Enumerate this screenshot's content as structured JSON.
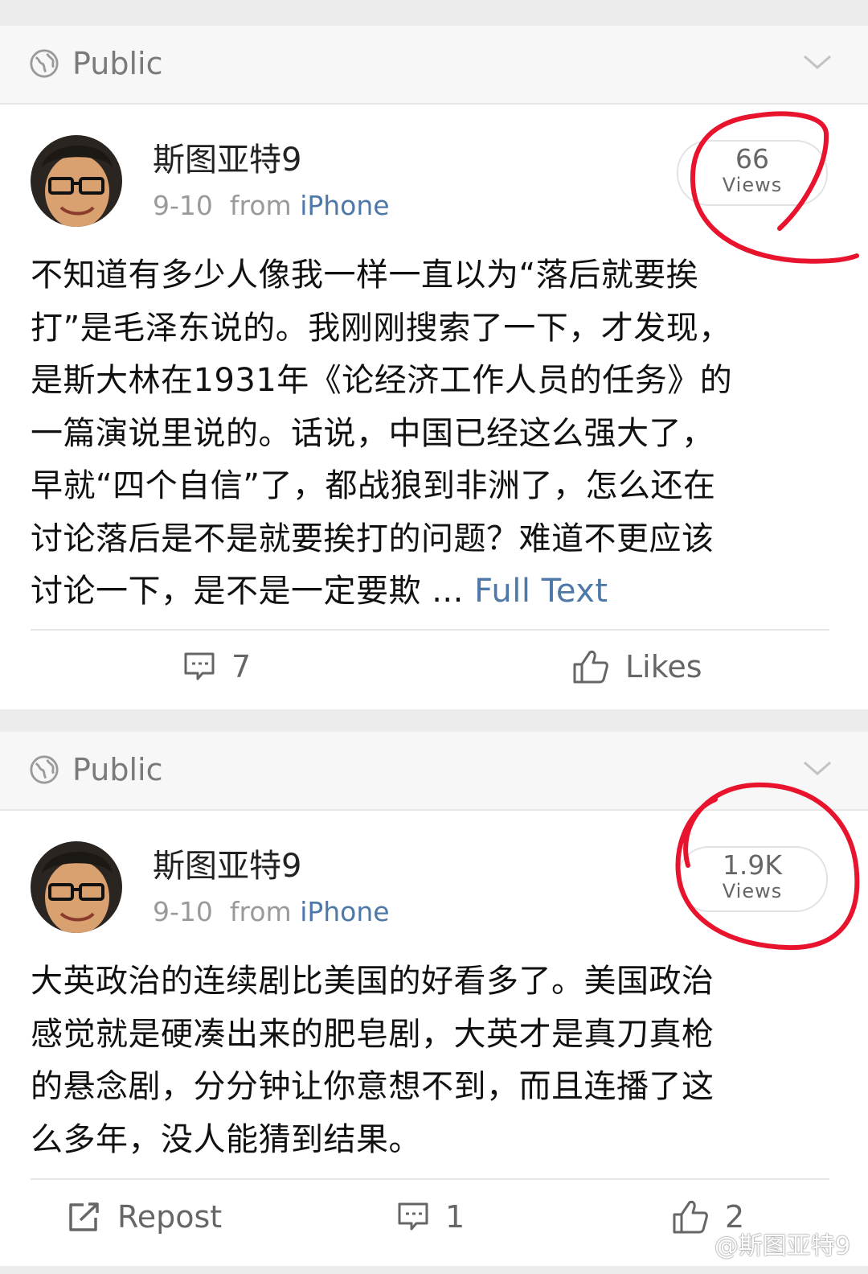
{
  "posts": [
    {
      "visibility": "Public",
      "author": "斯图亚特9",
      "date": "9-10",
      "from_label": "from",
      "source": "iPhone",
      "views_count": "66",
      "views_label": "Views",
      "text_lines": [
        "不知道有多少人像我一样一直以为“落后就要挨",
        "打”是毛泽东说的。我刚刚搜索了一下，才发现，",
        "是斯大林在1931年《论经济工作人员的任务》的",
        "一篇演说里说的。话说，中国已经这么强大了，",
        "早就“四个自信”了，都战狼到非洲了，怎么还在",
        "讨论落后是不是就要挨打的问题？难道不更应该",
        "讨论一下，是不是一定要欺 ..."
      ],
      "full_text_link": "Full Text",
      "comments_count": "7",
      "likes_label": "Likes"
    },
    {
      "visibility": "Public",
      "author": "斯图亚特9",
      "date": "9-10",
      "from_label": "from",
      "source": "iPhone",
      "views_count": "1.9K",
      "views_label": "Views",
      "text_lines": [
        "大英政治的连续剧比美国的好看多了。美国政治",
        "感觉就是硬凑出来的肥皂剧，大英才是真刀真枪",
        "的悬念剧，分分钟让你意想不到，而且连播了这",
        "么多年，没人能猜到结果。"
      ],
      "repost_label": "Repost",
      "comments_count": "1",
      "likes_count": "2"
    }
  ],
  "watermark": "@斯图亚特9",
  "colors": {
    "link_blue": "#4e78a8",
    "annotation_red": "#e8142d",
    "page_bg": "#ececec"
  },
  "icons": [
    "globe-icon",
    "chevron-down-icon",
    "comment-icon",
    "thumbs-up-icon",
    "repost-icon",
    "weibo-logo-icon"
  ]
}
